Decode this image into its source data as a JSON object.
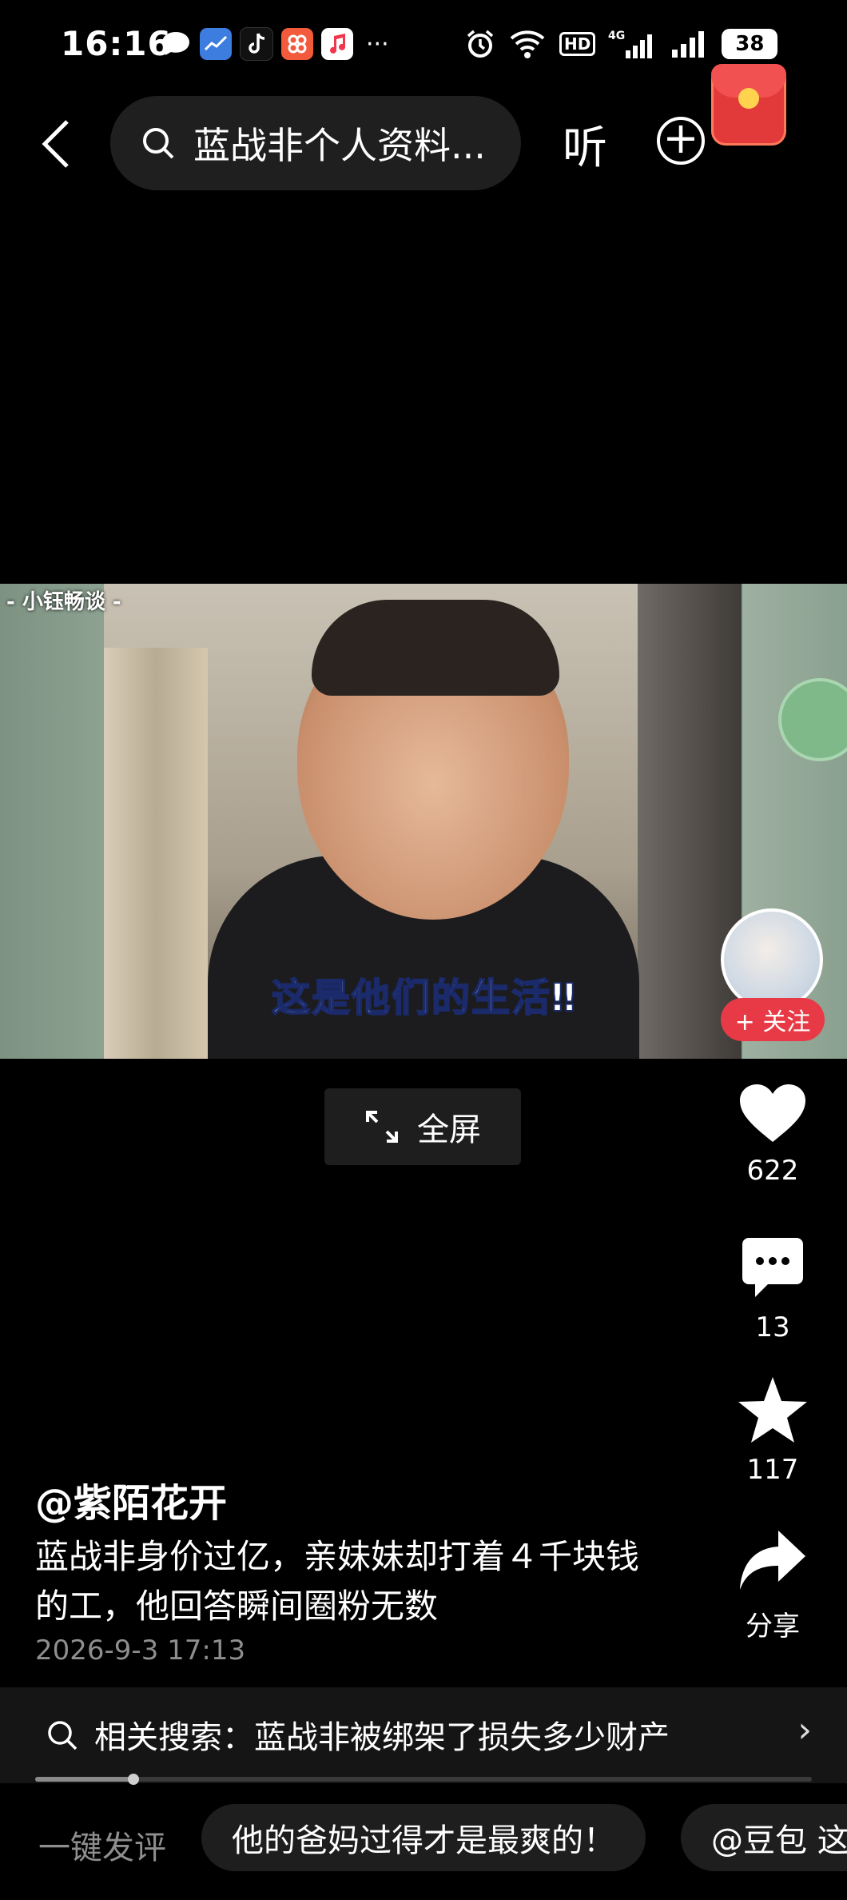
{
  "status_bar": {
    "time": "16:16",
    "app_icons": [
      "chat-bubble-icon",
      "weather-app-icon",
      "tiktok-icon",
      "shop-app-icon",
      "music-app-icon"
    ],
    "more": "···",
    "battery": "38"
  },
  "top_bar": {
    "search_text": "蓝战非个人资料...",
    "listen_label": "听"
  },
  "video": {
    "channel_tag": "- 小钰畅谈 -",
    "caption": "这是他们的生活‼"
  },
  "fullscreen_label": "全屏",
  "actions": {
    "follow_label": "+ 关注",
    "likes": "622",
    "comments": "13",
    "favorites": "117",
    "share_label": "分享"
  },
  "post": {
    "author": "@紫陌花开",
    "description": "蓝战非身价过亿，亲妹妹却打着４千块钱的工，他回答瞬间圈粉无数",
    "date": "2026-9-3 17:13"
  },
  "related_search": {
    "text": "相关搜索：蓝战非被绑架了损失多少财产"
  },
  "bottom": {
    "quick_comment": "一键发评",
    "chips": [
      "他的爸妈过得才是最爽的！",
      "@豆包 这"
    ]
  },
  "colors": {
    "background": "#000000",
    "follow_button": "#e83a46",
    "secondary_text": "#8e8e8e"
  }
}
